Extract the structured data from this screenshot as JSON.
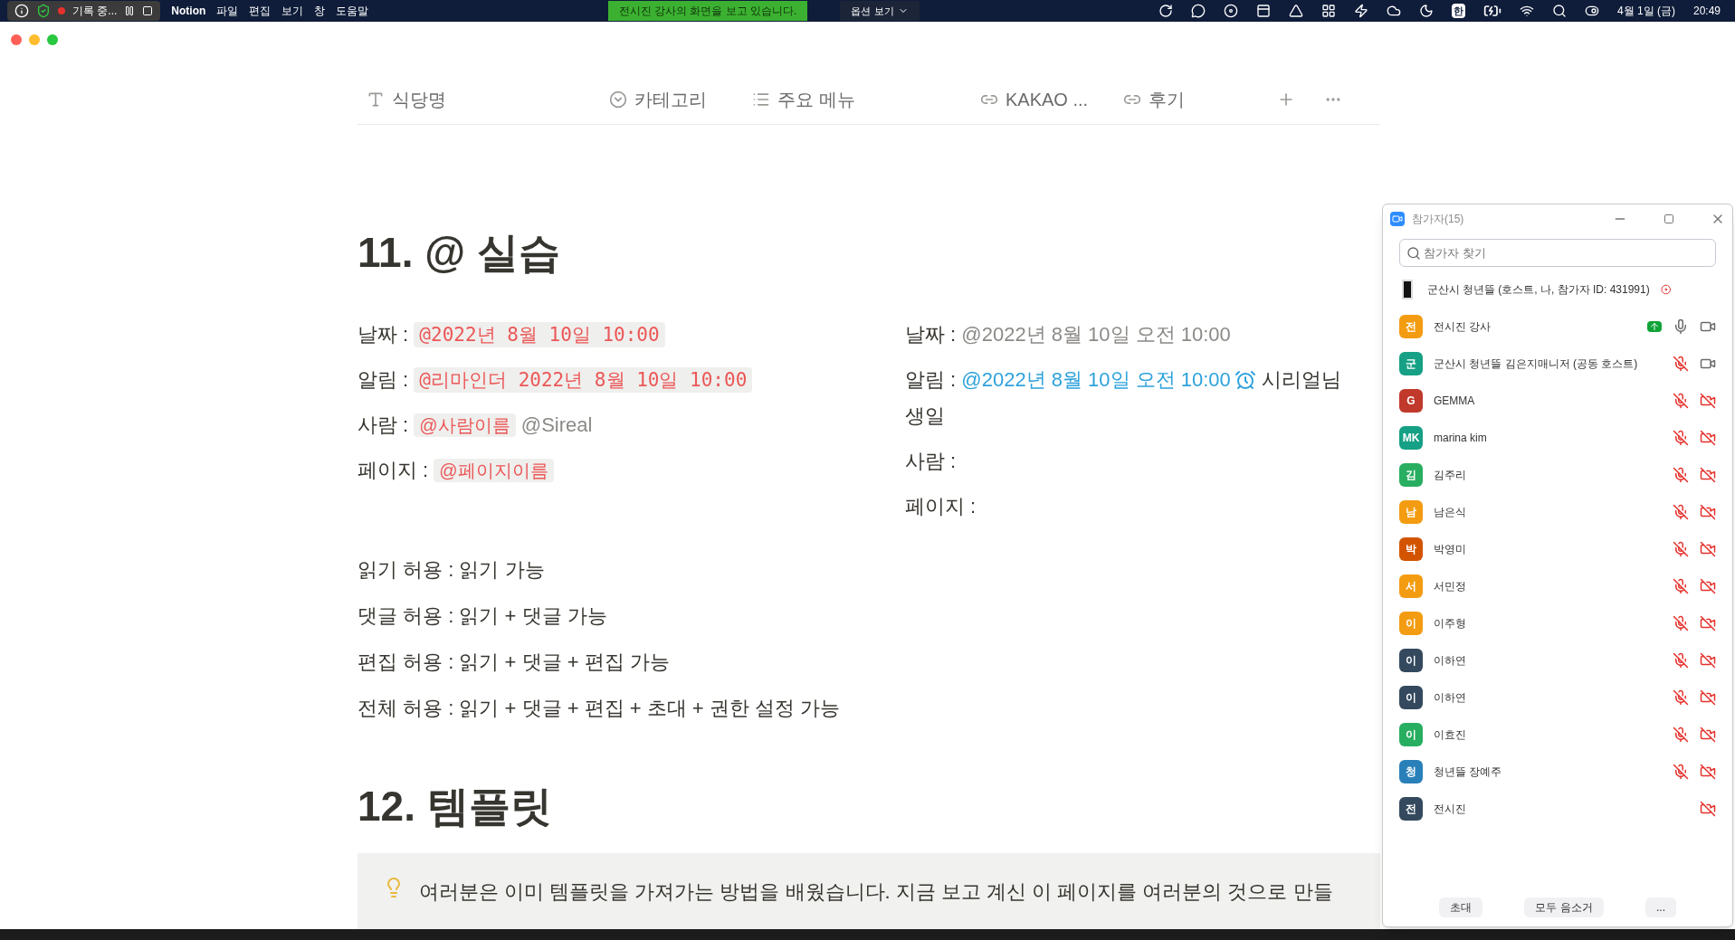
{
  "menu_bar": {
    "app": "Notion",
    "menus": [
      "파일",
      "편집",
      "보기",
      "창",
      "도움말"
    ],
    "recording": "기록 중...",
    "share_banner": "전시진 강사의 화면을 보고 있습니다.",
    "options": "옵션 보기",
    "input_method": "한",
    "date": "4월 1일 (금)",
    "time": "20:49"
  },
  "notion": {
    "properties": [
      {
        "kind": "text",
        "label": "식당명"
      },
      {
        "kind": "select",
        "label": "카테고리"
      },
      {
        "kind": "list",
        "label": "주요 메뉴"
      },
      {
        "kind": "relation",
        "label": "KAKAO ..."
      },
      {
        "kind": "relation",
        "label": "후기"
      }
    ],
    "heading_1": "11. @ 실습",
    "left_rows": [
      {
        "label": "날짜 :",
        "parts": [
          {
            "kind": "code",
            "text": "@2022년 8월 10일 10:00"
          }
        ]
      },
      {
        "label": "알림 :",
        "parts": [
          {
            "kind": "code",
            "text": "@리마인더 2022년 8월 10일 10:00"
          }
        ]
      },
      {
        "label": "사람 :",
        "parts": [
          {
            "kind": "chip",
            "text": "@사람이름"
          },
          {
            "kind": "mention",
            "text": "@Sireal"
          }
        ]
      },
      {
        "label": "페이지 :",
        "parts": [
          {
            "kind": "chip",
            "text": "@페이지이름"
          }
        ]
      }
    ],
    "right_rows": [
      {
        "label": "날짜 :",
        "parts": [
          {
            "kind": "mention",
            "text": "@2022년 8월 10일 오전 10:00"
          }
        ]
      },
      {
        "label": "알림 :",
        "parts": [
          {
            "kind": "reminder",
            "text": "@2022년 8월 10일 오전 10:00"
          },
          {
            "kind": "plain",
            "text": "시리얼님"
          },
          {
            "kind": "plain",
            "text": "생일"
          }
        ]
      },
      {
        "label": "사람 :",
        "parts": []
      },
      {
        "label": "페이지 :",
        "parts": []
      }
    ],
    "permissions": [
      "읽기 허용 : 읽기 가능",
      "댓글 허용 : 읽기 + 댓글 가능",
      "편집 허용 : 읽기 + 댓글 + 편집 가능",
      "전체 허용 : 읽기 + 댓글 + 편집 + 초대 + 권한 설정 가능"
    ],
    "heading_2": "12. 템플릿",
    "callout": "여러분은 이미 템플릿을 가져가는 방법을 배웠습니다. 지금 보고 계신 이 페이지를 여러분의 것으로 만들"
  },
  "participants_panel": {
    "title": "참가자(15)",
    "search": {
      "placeholder": "참가자 찾기"
    },
    "participants": [
      {
        "kind": "self",
        "name": "군산시 청년뜰 (호스트, 나, 참가자 ID: 431991)",
        "sharing": false
      },
      {
        "kind": "member",
        "avatar": "전",
        "color": "#f39c12",
        "name": "전시진 강사",
        "sharing": true,
        "muted": false,
        "video_off": false
      },
      {
        "kind": "member",
        "avatar": "군",
        "color": "#16a085",
        "name": "군산시 청년뜰 김은지매니저 (공동 호스트)",
        "sharing": false,
        "muted": true,
        "video_off": false
      },
      {
        "kind": "member",
        "avatar": "G",
        "color": "#c0392b",
        "name": "GEMMA",
        "sharing": false,
        "muted": true,
        "video_off": true
      },
      {
        "kind": "member",
        "avatar": "MK",
        "color": "#16a085",
        "name": "marina kim",
        "sharing": false,
        "muted": true,
        "video_off": true
      },
      {
        "kind": "member",
        "avatar": "김",
        "color": "#27ae60",
        "name": "김주리",
        "sharing": false,
        "muted": true,
        "video_off": true
      },
      {
        "kind": "member",
        "avatar": "남",
        "color": "#f39c12",
        "name": "남은식",
        "sharing": false,
        "muted": true,
        "video_off": true
      },
      {
        "kind": "member",
        "avatar": "박",
        "color": "#d35400",
        "name": "박영미",
        "sharing": false,
        "muted": true,
        "video_off": true
      },
      {
        "kind": "member",
        "avatar": "서",
        "color": "#f39c12",
        "name": "서민정",
        "sharing": false,
        "muted": true,
        "video_off": true
      },
      {
        "kind": "member",
        "avatar": "이",
        "color": "#f39c12",
        "name": "이주형",
        "sharing": false,
        "muted": true,
        "video_off": true
      },
      {
        "kind": "member",
        "avatar": "이",
        "color": "#34495e",
        "name": "이하연",
        "sharing": false,
        "muted": true,
        "video_off": true
      },
      {
        "kind": "member",
        "avatar": "이",
        "color": "#34495e",
        "name": "이하연",
        "sharing": false,
        "muted": true,
        "video_off": true
      },
      {
        "kind": "member",
        "avatar": "이",
        "color": "#27ae60",
        "name": "이효진",
        "sharing": false,
        "muted": true,
        "video_off": true
      },
      {
        "kind": "member",
        "avatar": "청",
        "color": "#2980b9",
        "name": "청년뜰 장예주",
        "sharing": false,
        "muted": true,
        "video_off": true
      },
      {
        "kind": "member",
        "avatar": "전",
        "color": "#34495e",
        "name": "전시진",
        "sharing": false,
        "video_off": true
      }
    ],
    "buttons": [
      "초대",
      "모두 음소거",
      "..."
    ]
  }
}
